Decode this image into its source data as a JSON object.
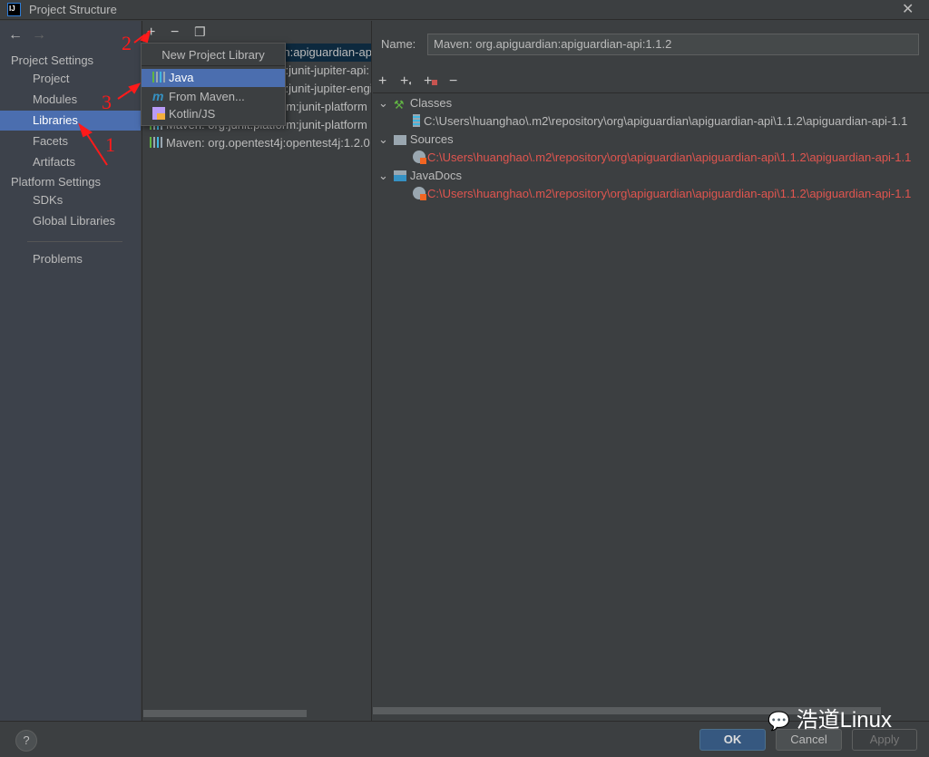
{
  "window": {
    "title": "Project Structure",
    "logo": "IJ"
  },
  "sidebar": {
    "sections": [
      {
        "label": "Project Settings"
      },
      {
        "label": "Platform Settings"
      }
    ],
    "items": [
      {
        "label": "Project"
      },
      {
        "label": "Modules"
      },
      {
        "label": "Libraries",
        "selected": true
      },
      {
        "label": "Facets"
      },
      {
        "label": "Artifacts"
      },
      {
        "label": "SDKs"
      },
      {
        "label": "Global Libraries"
      },
      {
        "label": "Problems"
      }
    ]
  },
  "libraries": [
    "Maven: org.apiguardian:apiguardian-api:1.1.2",
    "Maven: org.junit.jupiter:junit-jupiter-api:",
    "Maven: org.junit.jupiter:junit-jupiter-engine",
    "Maven: org.junit.platform:junit-platform",
    "Maven: org.junit.platform:junit-platform",
    "Maven: org.opentest4j:opentest4j:1.2.0"
  ],
  "popup": {
    "header": "New Project Library",
    "items": [
      {
        "label": "Java",
        "icon": "library-icon",
        "selected": true
      },
      {
        "label": "From Maven...",
        "icon": "maven-icon"
      },
      {
        "label": "Kotlin/JS",
        "icon": "kotlin-js-icon"
      }
    ]
  },
  "detail": {
    "name_label": "Name:",
    "name_value": "Maven: org.apiguardian:apiguardian-api:1.1.2",
    "nodes": [
      {
        "label": "Classes",
        "path": "C:\\Users\\huanghao\\.m2\\repository\\org\\apiguardian\\apiguardian-api\\1.1.2\\apiguardian-api-1.1",
        "missing": false
      },
      {
        "label": "Sources",
        "path": "C:\\Users\\huanghao\\.m2\\repository\\org\\apiguardian\\apiguardian-api\\1.1.2\\apiguardian-api-1.1",
        "missing": true
      },
      {
        "label": "JavaDocs",
        "path": "C:\\Users\\huanghao\\.m2\\repository\\org\\apiguardian\\apiguardian-api\\1.1.2\\apiguardian-api-1.1",
        "missing": true
      }
    ]
  },
  "annotations": [
    "1",
    "2",
    "3"
  ],
  "buttons": {
    "help": "?",
    "ok": "OK",
    "cancel": "Cancel",
    "apply": "Apply"
  },
  "watermark": "浩道Linux",
  "colors": {
    "selection": "#4b6eaf",
    "error": "#e0554f",
    "ok_button": "#365880"
  }
}
